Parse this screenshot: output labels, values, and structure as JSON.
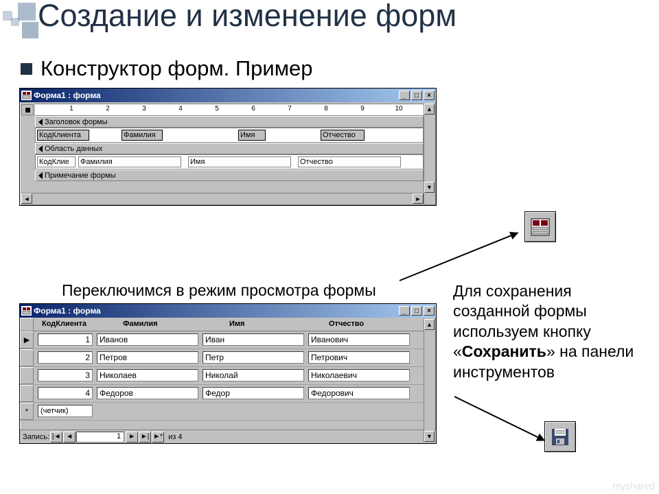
{
  "slide": {
    "title": "Создание и изменение форм",
    "bullet": "Конструктор форм. Пример",
    "caption_switch": "Переключимся в режим просмотра формы",
    "caption_save_1": "Для сохранения созданной формы используем кнопку «",
    "caption_save_bold": "Сохранить",
    "caption_save_2": "» на панели инструментов",
    "watermark": "myshared"
  },
  "win1": {
    "title": "Форма1 : форма",
    "sections": {
      "header": "Заголовок формы",
      "detail": "Область данных",
      "footer": "Примечание формы"
    },
    "header_fields": [
      "КодКлиента",
      "Фамилия",
      "Имя",
      "Отчество"
    ],
    "detail_fields": [
      "КодКлие",
      "Фамилия",
      "Имя",
      "Отчество"
    ],
    "ruler_ticks": [
      "1",
      "2",
      "3",
      "4",
      "5",
      "6",
      "7",
      "8",
      "9",
      "10"
    ]
  },
  "win2": {
    "title": "Форма1 : форма",
    "columns": [
      "КодКлиента",
      "Фамилия",
      "Имя",
      "Отчество"
    ],
    "rows": [
      {
        "id": "1",
        "f": "Иванов",
        "i": "Иван",
        "o": "Иванович"
      },
      {
        "id": "2",
        "f": "Петров",
        "i": "Петр",
        "o": "Петрович"
      },
      {
        "id": "3",
        "f": "Николаев",
        "i": "Николай",
        "o": "Николаевич"
      },
      {
        "id": "4",
        "f": "Федоров",
        "i": "Федор",
        "o": "Федорович"
      }
    ],
    "new_row": "(четчик)",
    "nav": {
      "label": "Запись:",
      "current": "1",
      "of": "из 4"
    }
  },
  "icons": {
    "form_view": "form-view-icon",
    "save": "save-icon"
  }
}
